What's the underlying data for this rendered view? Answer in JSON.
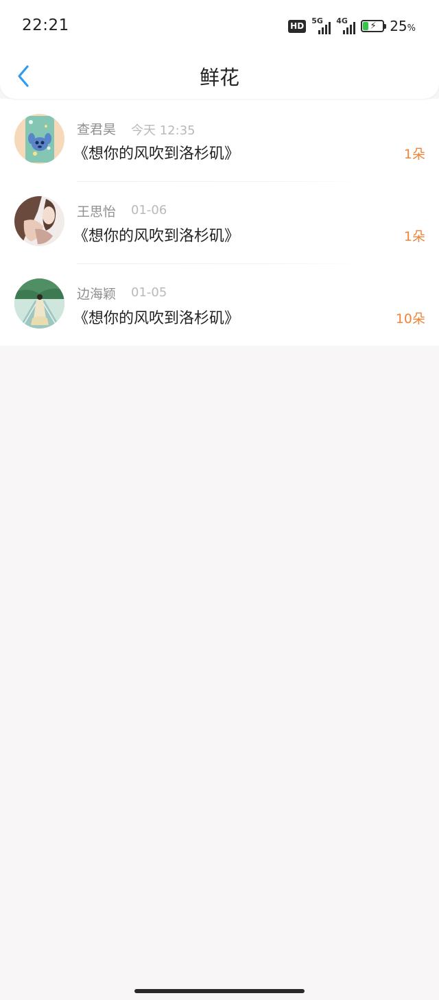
{
  "status_bar": {
    "time": "22:21",
    "hd_badge": "HD",
    "network_1": "5G",
    "network_2": "4G",
    "battery_percent": "25",
    "battery_unit": "%",
    "battery_level": 0.25,
    "battery_icon": "battery-charging-icon"
  },
  "nav": {
    "title": "鲜花",
    "back_icon": "chevron-left-icon",
    "accent_color": "#2f9bf0"
  },
  "gifts": [
    {
      "name": "查君昊",
      "time": "今天 12:35",
      "song": "《想你的风吹到洛杉矶》",
      "count": "1朵"
    },
    {
      "name": "王思怡",
      "time": "01-06",
      "song": "《想你的风吹到洛杉矶》",
      "count": "1朵"
    },
    {
      "name": "边海颖",
      "time": "01-05",
      "song": "《想你的风吹到洛杉矶》",
      "count": "10朵"
    }
  ],
  "colors": {
    "count": "#f0843a",
    "background": "#f8f6f7"
  }
}
